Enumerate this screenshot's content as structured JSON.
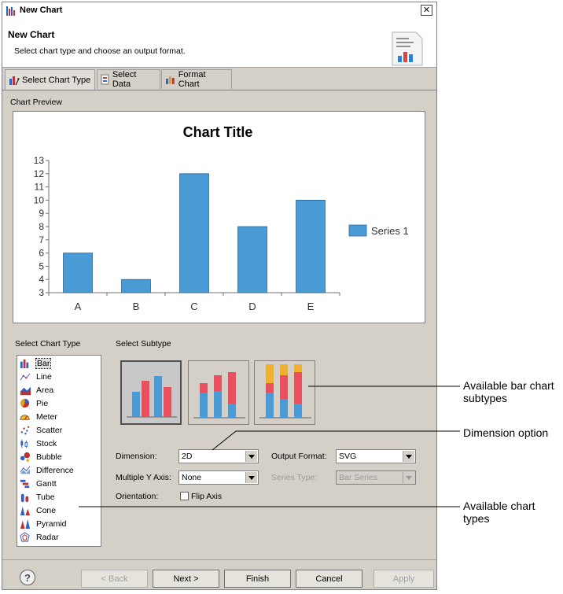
{
  "window": {
    "title": "New Chart",
    "close_label": "✕"
  },
  "header": {
    "title": "New Chart",
    "description": "Select chart type and choose an output format."
  },
  "tabs": [
    {
      "label": "Select Chart Type"
    },
    {
      "label": "Select Data"
    },
    {
      "label": "Format Chart"
    }
  ],
  "preview": {
    "label": "Chart Preview"
  },
  "chart_data": {
    "type": "bar",
    "title": "Chart Title",
    "categories": [
      "A",
      "B",
      "C",
      "D",
      "E"
    ],
    "series": [
      {
        "name": "Series 1",
        "values": [
          6,
          4,
          12,
          8,
          10
        ],
        "color": "#4a9ad6"
      }
    ],
    "ylim": [
      3,
      13
    ],
    "yticks": [
      3,
      4,
      5,
      6,
      7,
      8,
      9,
      10,
      11,
      12,
      13
    ],
    "legend": "right",
    "grid": false
  },
  "chart_type": {
    "label": "Select Chart Type",
    "items": [
      {
        "label": "Bar",
        "icon": "bar-chart-icon"
      },
      {
        "label": "Line",
        "icon": "line-chart-icon"
      },
      {
        "label": "Area",
        "icon": "area-chart-icon"
      },
      {
        "label": "Pie",
        "icon": "pie-chart-icon"
      },
      {
        "label": "Meter",
        "icon": "meter-chart-icon"
      },
      {
        "label": "Scatter",
        "icon": "scatter-chart-icon"
      },
      {
        "label": "Stock",
        "icon": "stock-chart-icon"
      },
      {
        "label": "Bubble",
        "icon": "bubble-chart-icon"
      },
      {
        "label": "Difference",
        "icon": "difference-chart-icon"
      },
      {
        "label": "Gantt",
        "icon": "gantt-chart-icon"
      },
      {
        "label": "Tube",
        "icon": "tube-chart-icon"
      },
      {
        "label": "Cone",
        "icon": "cone-chart-icon"
      },
      {
        "label": "Pyramid",
        "icon": "pyramid-chart-icon"
      },
      {
        "label": "Radar",
        "icon": "radar-chart-icon"
      }
    ],
    "selected": "Bar"
  },
  "subtype": {
    "label": "Select Subtype"
  },
  "options": {
    "dimension_label": "Dimension:",
    "dimension_value": "2D",
    "output_format_label": "Output Format:",
    "output_format_value": "SVG",
    "multiple_y_label": "Multiple Y Axis:",
    "multiple_y_value": "None",
    "series_type_label": "Series Type:",
    "series_type_value": "Bar Series",
    "orientation_label": "Orientation:",
    "flip_axis_label": "Flip Axis",
    "flip_axis_checked": false
  },
  "buttons": {
    "back": "< Back",
    "next": "Next >",
    "finish": "Finish",
    "cancel": "Cancel",
    "apply": "Apply",
    "help": "?"
  },
  "callouts": {
    "subtypes": "Available bar chart subtypes",
    "dimension": "Dimension option",
    "types": "Available chart types"
  },
  "colors": {
    "bar_blue": "#4a9ad6",
    "bar_red": "#e8505e",
    "bar_orange": "#f0b030"
  }
}
